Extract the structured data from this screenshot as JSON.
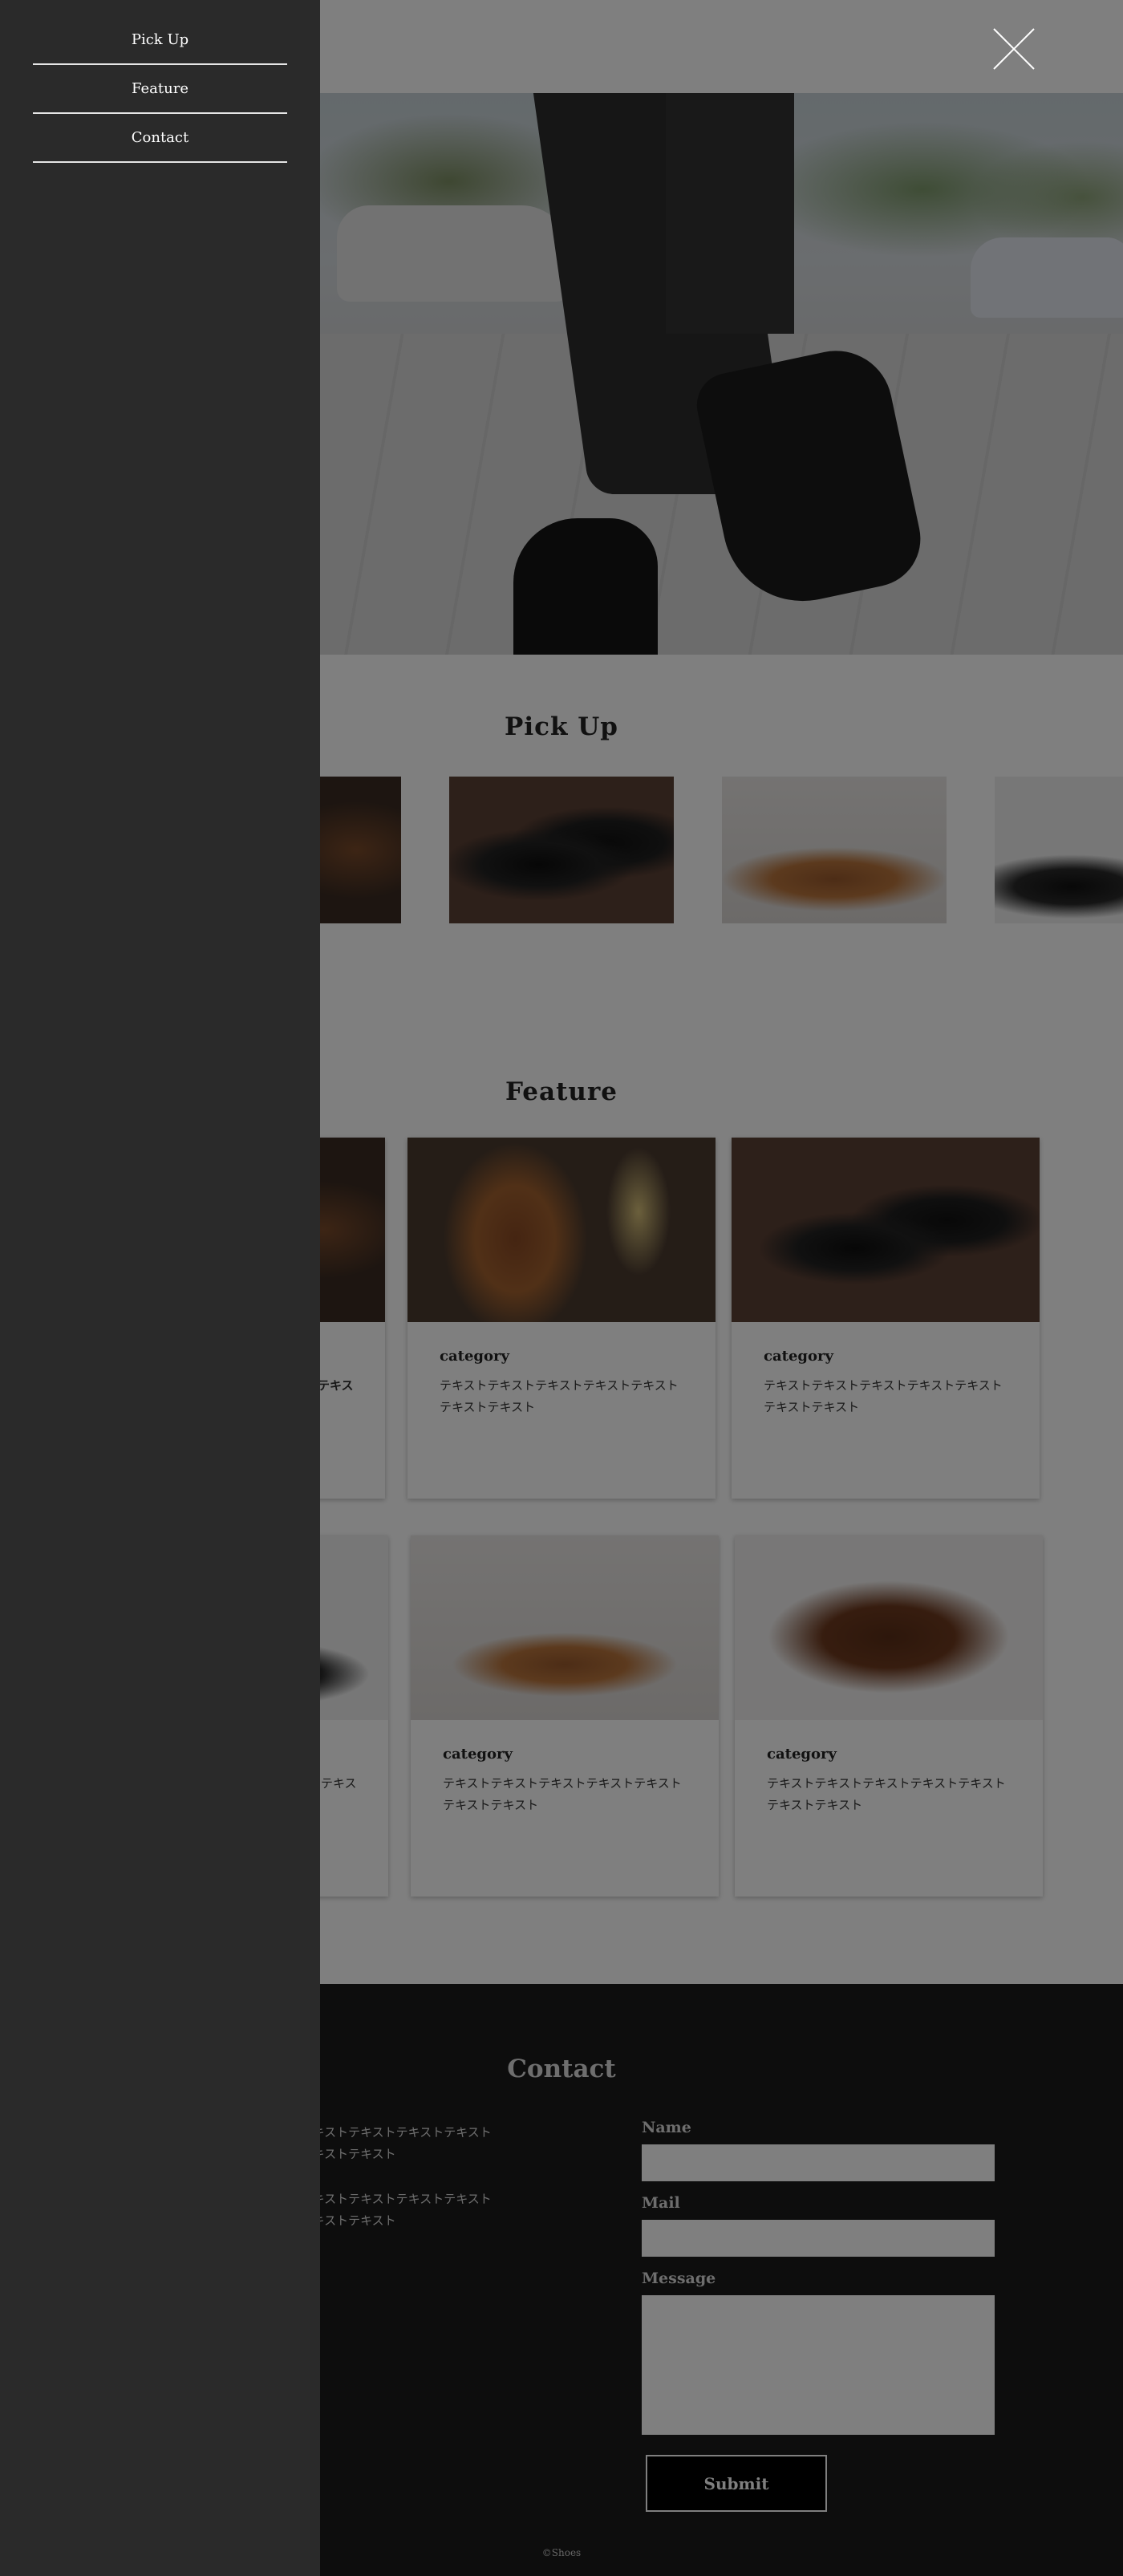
{
  "nav": {
    "items": [
      {
        "label": "Pick Up"
      },
      {
        "label": "Feature"
      },
      {
        "label": "Contact"
      }
    ]
  },
  "sections": {
    "pickup_title": "Pick Up",
    "feature_title": "Feature",
    "contact_title": "Contact"
  },
  "feature": {
    "row1": [
      {
        "category": "",
        "text": "テキス"
      },
      {
        "category": "category",
        "text": "テキストテキストテキストテキストテキストテキストテキスト"
      },
      {
        "category": "category",
        "text": "テキストテキストテキストテキストテキストテキストテキスト"
      }
    ],
    "row2": [
      {
        "category": "",
        "text": "テキス"
      },
      {
        "category": "category",
        "text": "テキストテキストテキストテキストテキストテキストテキスト"
      },
      {
        "category": "category",
        "text": "テキストテキストテキストテキストテキストテキストテキスト"
      }
    ]
  },
  "contact": {
    "para1": "テキストテキストテキストテキストテキストテキストテキストテキスト",
    "para2": "テキストテキストテキストテキストテキストテキストテキストテキスト",
    "name_label": "Name",
    "mail_label": "Mail",
    "message_label": "Message",
    "name_value": "",
    "mail_value": "",
    "message_value": "",
    "submit_label": "Submit",
    "copyright": "©Shoes"
  },
  "icons": {
    "close": "close-icon"
  },
  "colors": {
    "drawer_bg": "#2a2a2a",
    "contact_bg": "#1b1b1b",
    "overlay": "rgba(0,0,0,0.5)"
  }
}
